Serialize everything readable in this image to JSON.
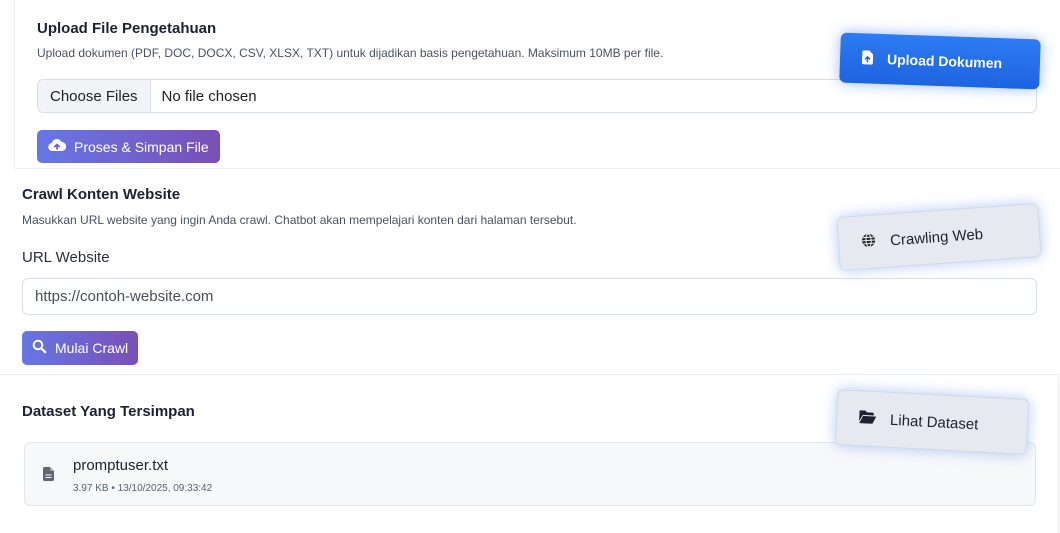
{
  "upload": {
    "title": "Upload File Pengetahuan",
    "description": "Upload dokumen (PDF, DOC, DOCX, CSV, XLSX, TXT) untuk dijadikan basis pengetahuan. Maksimum 10MB per file.",
    "choose_label": "Choose Files",
    "status": "No file chosen",
    "process_label": "Proses & Simpan File"
  },
  "crawl": {
    "title": "Crawl Konten Website",
    "description": "Masukkan URL website yang ingin Anda crawl. Chatbot akan mempelajari konten dari halaman tersebut.",
    "url_label": "URL Website",
    "url_placeholder": "https://contoh-website.com",
    "start_label": "Mulai Crawl"
  },
  "dataset": {
    "title": "Dataset Yang Tersimpan",
    "files": [
      {
        "name": "promptuser.txt",
        "meta": "3.97 KB • 13/10/2025, 09:33:42"
      }
    ]
  },
  "floating_buttons": {
    "upload_doc": "Upload Dokumen",
    "crawl_web": "Crawling Web",
    "view_dataset": "Lihat Dataset"
  },
  "colors": {
    "primary_gradient_start": "#6677e6",
    "primary_gradient_end": "#7a4fb5",
    "upload_button_blue": "#2d7cf3",
    "floating_bg": "#e6e9ef"
  }
}
